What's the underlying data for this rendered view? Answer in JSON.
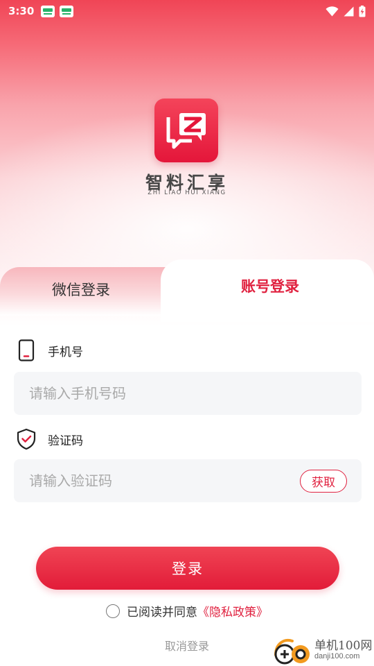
{
  "status_bar": {
    "time": "3:30"
  },
  "app": {
    "name_cn": "智料汇享",
    "name_en": "ZHI LIAO HUI XIANG"
  },
  "tabs": [
    {
      "label": "微信登录",
      "active": false
    },
    {
      "label": "账号登录",
      "active": true
    }
  ],
  "phone_field": {
    "label": "手机号",
    "placeholder": "请输入手机号码",
    "value": ""
  },
  "code_field": {
    "label": "验证码",
    "placeholder": "请输入验证码",
    "value": "",
    "get_code_label": "获取"
  },
  "login_button": {
    "label": "登录"
  },
  "agreement": {
    "prefix": "已阅读并同意",
    "policy_link": "《隐私政策》",
    "checked": false
  },
  "cancel_login": "取消登录",
  "watermark": {
    "cn": "单机100网",
    "en": "danji100.com"
  },
  "colors": {
    "accent": "#e0213f",
    "input_bg": "#f5f6f8",
    "placeholder": "#a9a9a9"
  }
}
